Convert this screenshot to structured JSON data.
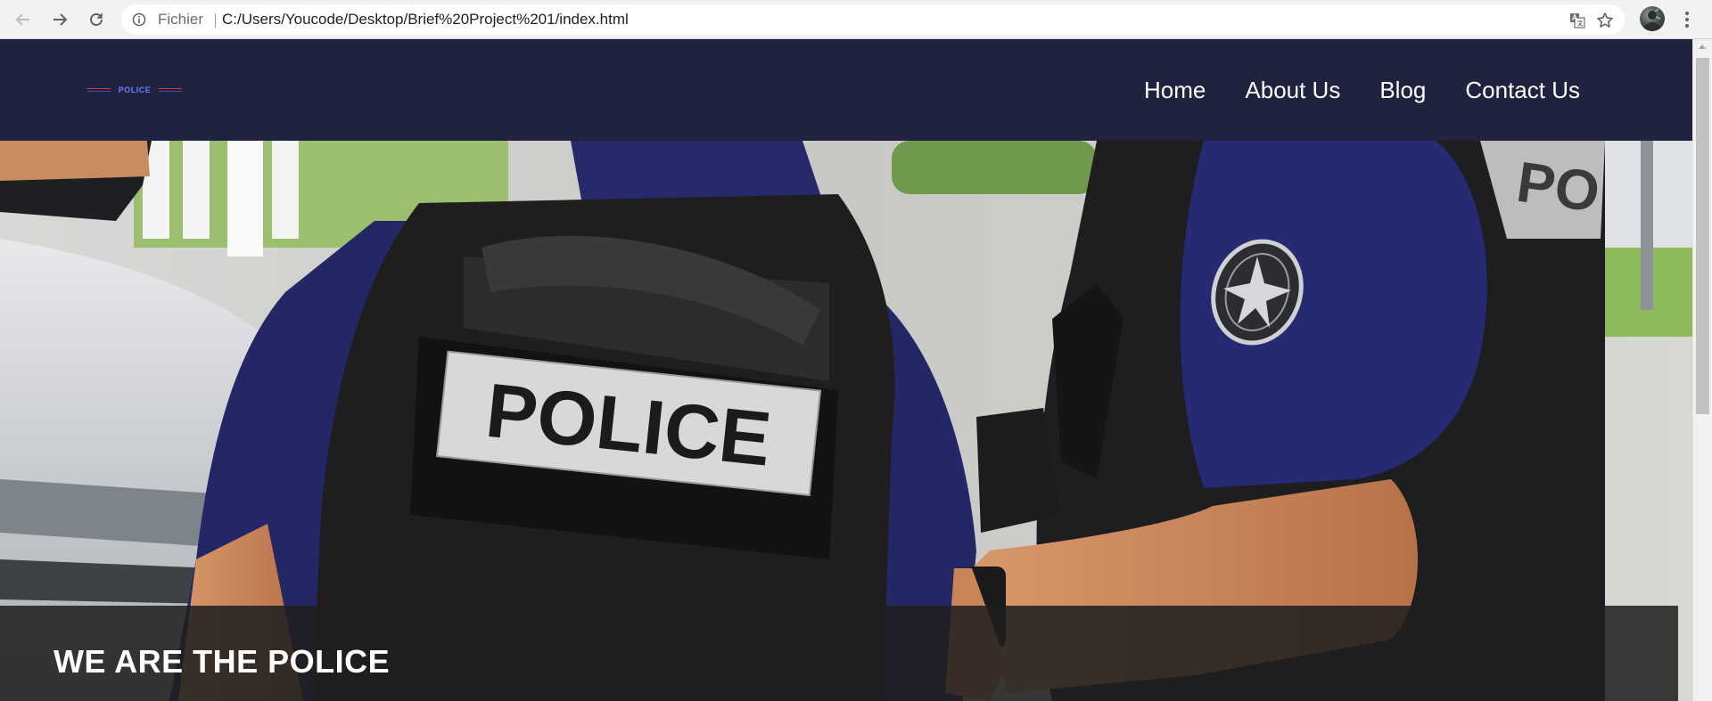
{
  "browser": {
    "scheme_label": "Fichier",
    "url": "C:/Users/Youcode/Desktop/Brief%20Project%201/index.html",
    "icons": [
      "back-arrow-icon",
      "forward-arrow-icon",
      "reload-icon",
      "info-icon",
      "translate-icon",
      "star-icon",
      "more-menu-icon"
    ]
  },
  "header": {
    "logo_text": "POLICE",
    "nav": [
      {
        "label": "Home"
      },
      {
        "label": "About Us"
      },
      {
        "label": "Blog"
      },
      {
        "label": "Contact Us"
      }
    ],
    "background": "#1f2340"
  },
  "hero": {
    "vest_patch_text": "POLICE",
    "caption": "WE ARE THE POLICE"
  },
  "colors": {
    "uniform_navy": "#232765",
    "vest_black": "#1f1d1e",
    "caption_overlay": "#1e1e1e"
  }
}
